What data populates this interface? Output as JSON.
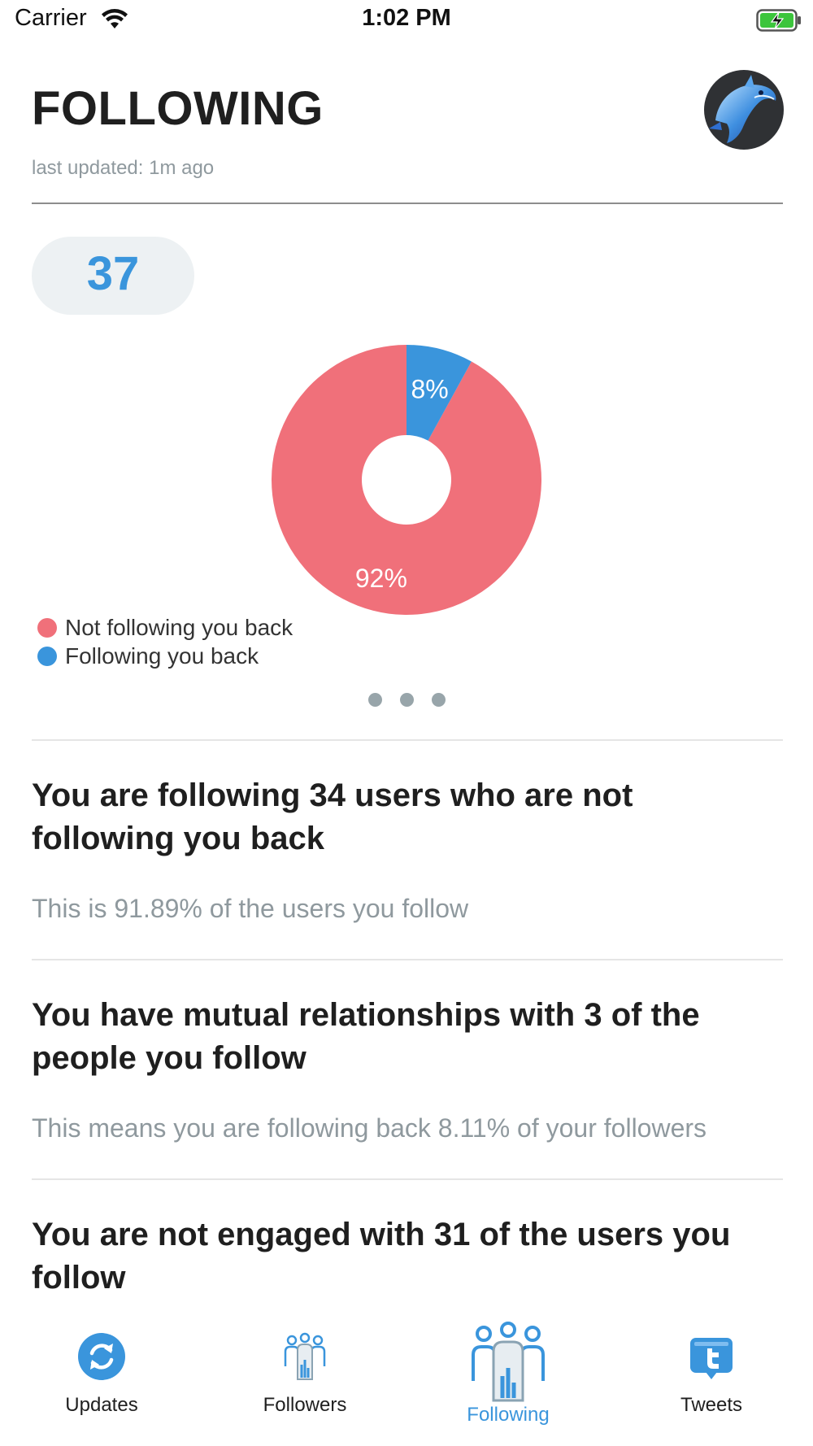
{
  "status_bar": {
    "carrier": "Carrier",
    "time": "1:02 PM"
  },
  "header": {
    "title": "FOLLOWING",
    "last_updated": "last updated: 1m ago"
  },
  "summary": {
    "count": "37"
  },
  "chart_data": {
    "type": "pie",
    "categories": [
      "Not following you back",
      "Following you back"
    ],
    "values": [
      92,
      8
    ],
    "labels": [
      "92%",
      "8%"
    ],
    "colors": [
      "#f0707a",
      "#3a95dc"
    ],
    "legend_placement": "bottom-left"
  },
  "insights": [
    {
      "title": "You are following 34 users who are not following you back",
      "subtitle": "This is 91.89% of the users you follow"
    },
    {
      "title": "You have mutual relationships with 3 of the people you follow",
      "subtitle": "This means you are following back 8.11% of your followers"
    },
    {
      "title": "You are not engaged with 31 of the users you follow",
      "subtitle": ""
    }
  ],
  "tabs": [
    {
      "label": "Updates",
      "icon": "updates-icon",
      "active": false
    },
    {
      "label": "Followers",
      "icon": "followers-icon",
      "active": false
    },
    {
      "label": "Following",
      "icon": "following-icon",
      "active": true
    },
    {
      "label": "Tweets",
      "icon": "tweets-icon",
      "active": false
    }
  ],
  "colors": {
    "accent": "#3a95dc",
    "not_following": "#f0707a",
    "muted_text": "#8f999e",
    "battery": "#3cc53c"
  }
}
